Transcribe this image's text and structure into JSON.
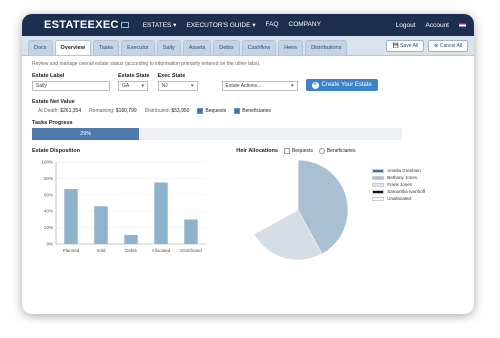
{
  "topbar": {
    "logo": "ESTATEEXEC",
    "nav": [
      "ESTATES ▾",
      "EXECUTOR'S GUIDE ▾",
      "FAQ",
      "COMPANY"
    ],
    "logout": "Logout",
    "account": "Account"
  },
  "tabs": [
    "Docs",
    "Overview",
    "Tasks",
    "Executor",
    "Sally",
    "Assets",
    "Debts",
    "Cashflow",
    "Heirs",
    "Distributions"
  ],
  "tab_buttons": {
    "save": "Save All",
    "cancel": "Cancel All"
  },
  "intro": "Review and manage overall estate status (according to information primarily entered on the other tabs).",
  "form": {
    "estate_label": {
      "label": "Estate Label",
      "value": "Sally"
    },
    "estate_state": {
      "label": "Estate State",
      "value": "GA"
    },
    "exec_state": {
      "label": "Exec State",
      "value": "NJ"
    },
    "actions": {
      "value": "Estate Actions..."
    },
    "create_button": "Create Your Estate"
  },
  "net_value": {
    "title": "Estate Net Value",
    "at_death_label": "At Death:",
    "at_death": "$261,354",
    "remaining_label": "Remaining:",
    "remaining": "$180,799",
    "distributed_label": "Distributed:",
    "distributed": "$53,950",
    "bequests": "Bequests",
    "beneficiaries": "Beneficiaries"
  },
  "progress": {
    "title": "Tasks Progress",
    "percent": 29,
    "label": "29%"
  },
  "chart_data": [
    {
      "type": "bar",
      "title": "Estate Disposition",
      "categories": [
        "Planned",
        "Sold",
        "Debts",
        "Allocated",
        "Distributed"
      ],
      "values": [
        67,
        46,
        11,
        75,
        30
      ],
      "yticks": [
        "100%",
        "80%",
        "60%",
        "40%",
        "20%",
        "0%"
      ],
      "ylim": [
        0,
        100
      ],
      "color": "#8fb3cc"
    },
    {
      "type": "pie",
      "title": "Heir Allocations",
      "checkboxes": [
        "Bequests",
        "Beneficiaries"
      ],
      "labels": [
        "Amelia Gresham",
        "Bethany Jones",
        "Frank Jones",
        "Samantha Ivanhoff",
        "Unallocated"
      ],
      "colors": [
        "#3e6ea8",
        "#a9c0d8",
        "#dce4ec",
        "#111111",
        "#ffffff"
      ],
      "values": [
        0,
        42,
        25,
        0,
        33
      ],
      "slice_colors": [
        "#a9bfd4",
        "#d6dde4",
        "#ffffff"
      ]
    }
  ]
}
